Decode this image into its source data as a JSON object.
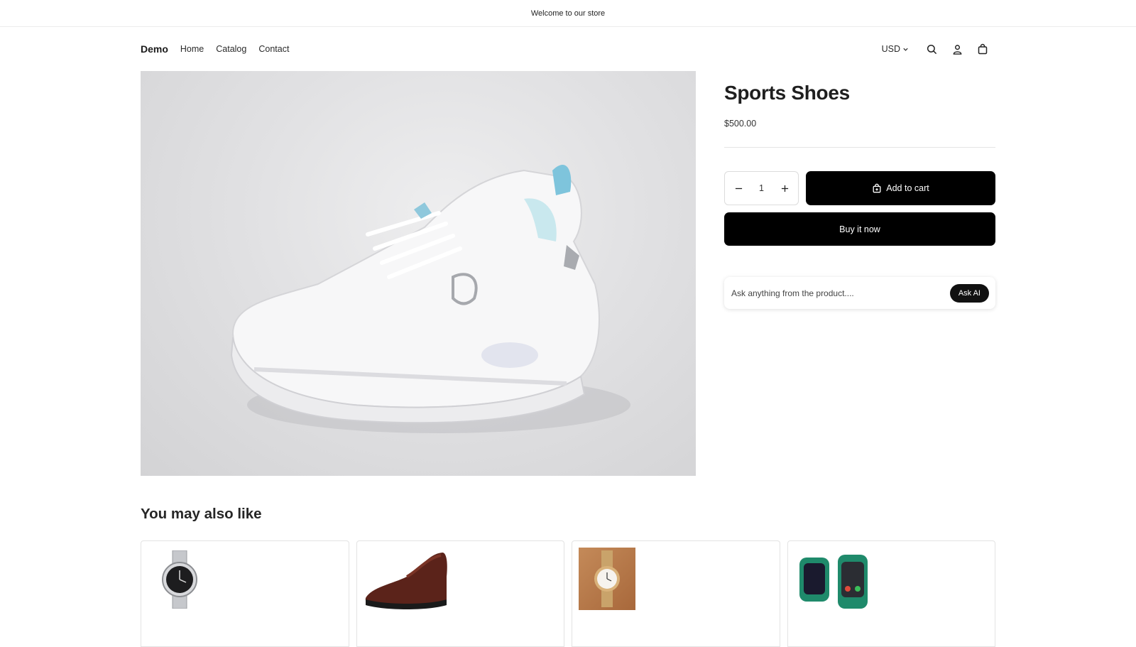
{
  "announcement": "Welcome to our store",
  "header": {
    "logo": "Demo",
    "nav": [
      "Home",
      "Catalog",
      "Contact"
    ],
    "currency": "USD"
  },
  "product": {
    "title": "Sports Shoes",
    "price": "$500.00",
    "quantity": "1",
    "add_to_cart": "Add to cart",
    "buy_now": "Buy it now"
  },
  "ask": {
    "placeholder": "Ask anything from the product....",
    "button": "Ask AI"
  },
  "recommendations": {
    "title": "You may also like",
    "items": [
      {
        "image": "silver-watch-black-dial"
      },
      {
        "image": "brown-leather-shoe"
      },
      {
        "image": "gold-watch-on-wood"
      },
      {
        "image": "green-smartwatch"
      }
    ]
  },
  "colors": {
    "button": "#000000",
    "text": "#121212",
    "border": "#e3e3e3"
  }
}
